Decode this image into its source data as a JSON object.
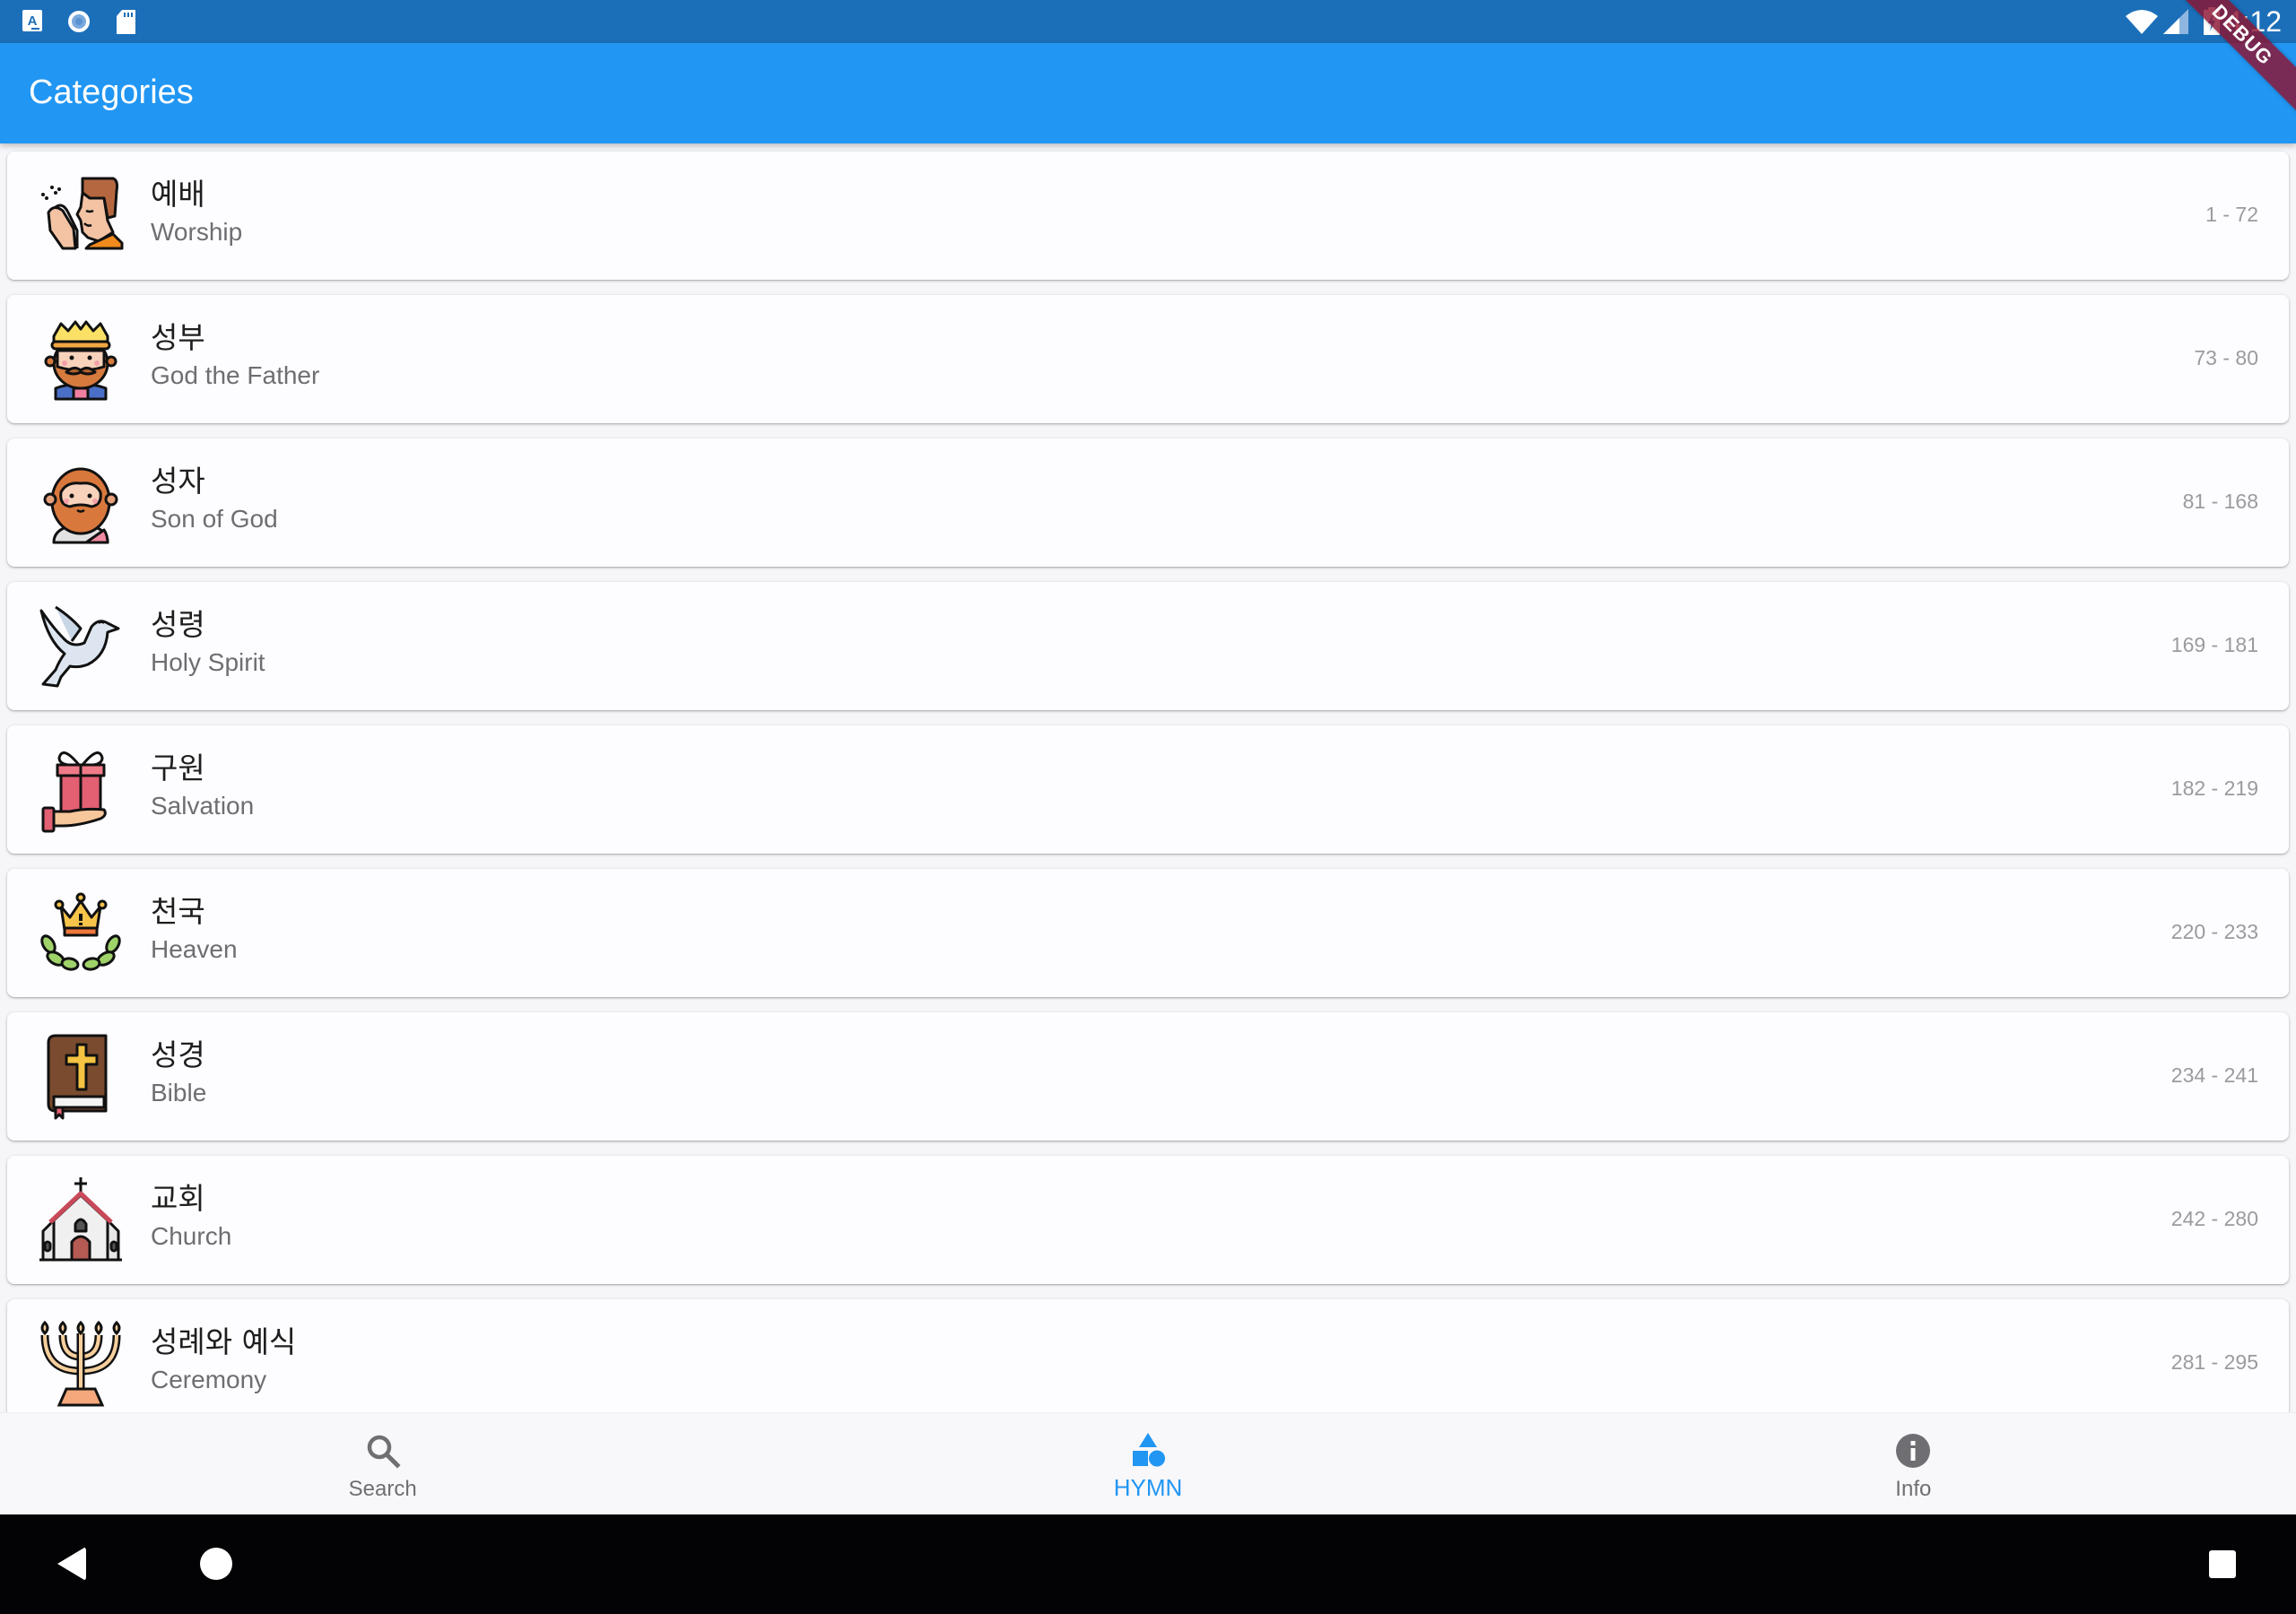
{
  "status_bar": {
    "left_icons": [
      "keyboard-a-icon",
      "sync-circle-icon",
      "sd-card-icon"
    ],
    "right_icons": [
      "wifi-icon",
      "cell-signal-icon",
      "battery-charging-icon"
    ],
    "time": "4:12"
  },
  "debug_banner": "DEBUG",
  "app_bar": {
    "title": "Categories"
  },
  "categories": [
    {
      "title": "예배",
      "subtitle": "Worship",
      "range": "1 - 72",
      "icon": "praying-man-icon"
    },
    {
      "title": "성부",
      "subtitle": "God the Father",
      "range": "73 - 80",
      "icon": "crowned-king-icon"
    },
    {
      "title": "성자",
      "subtitle": "Son of God",
      "range": "81 - 168",
      "icon": "jesus-icon"
    },
    {
      "title": "성령",
      "subtitle": "Holy Spirit",
      "range": "169 - 181",
      "icon": "dove-icon"
    },
    {
      "title": "구원",
      "subtitle": "Salvation",
      "range": "182 - 219",
      "icon": "gift-hand-icon"
    },
    {
      "title": "천국",
      "subtitle": "Heaven",
      "range": "220 - 233",
      "icon": "crown-laurel-icon"
    },
    {
      "title": "성경",
      "subtitle": "Bible",
      "range": "234 - 241",
      "icon": "bible-icon"
    },
    {
      "title": "교회",
      "subtitle": "Church",
      "range": "242 - 280",
      "icon": "church-icon"
    },
    {
      "title": "성례와 예식",
      "subtitle": "Ceremony",
      "range": "281 - 295",
      "icon": "menorah-icon"
    }
  ],
  "bottom_nav": {
    "items": [
      {
        "label": "Search",
        "icon": "search-icon",
        "active": false
      },
      {
        "label": "HYMN",
        "icon": "shapes-icon",
        "active": true
      },
      {
        "label": "Info",
        "icon": "info-icon",
        "active": false
      }
    ]
  },
  "colors": {
    "primary": "#2196f3",
    "status_bar": "#1b6fb9",
    "inactive": "#6f6e72",
    "debug_banner": "#8c1432"
  },
  "system_nav": [
    "back-icon",
    "home-icon",
    "recents-icon"
  ]
}
